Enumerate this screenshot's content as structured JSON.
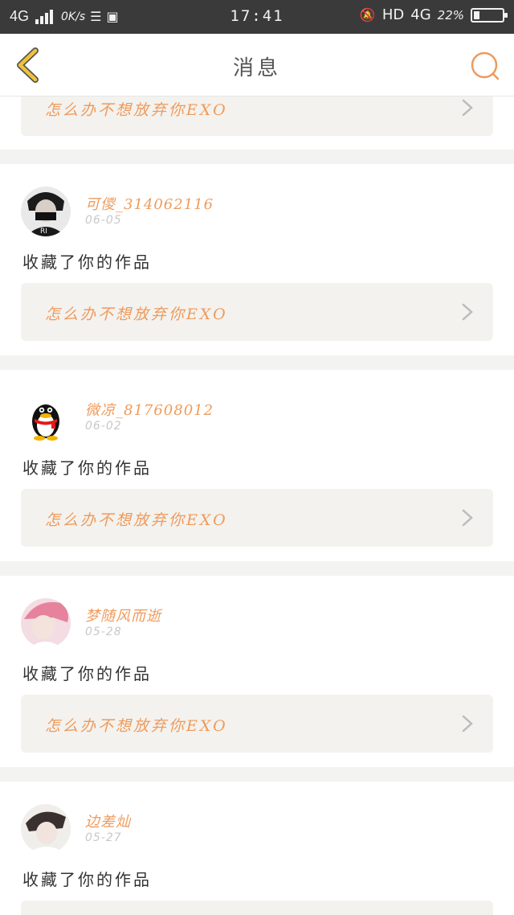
{
  "status_bar": {
    "network_left": "4G",
    "speed": "0K/s",
    "time": "17:41",
    "hd": "HD",
    "network_right": "4G",
    "battery": "22%",
    "battery_level": 0.22
  },
  "header": {
    "title": "消息",
    "back_icon": "chevron-left-icon",
    "search_icon": "search-icon"
  },
  "top_partial": {
    "work_title": "怎么办不想放弃你EXO"
  },
  "notifications": [
    {
      "username": "可儍_314062116",
      "date": "06-05",
      "action": "收藏了你的作品",
      "work_title": "怎么办不想放弃你EXO"
    },
    {
      "username": "微凉_817608012",
      "date": "06-02",
      "action": "收藏了你的作品",
      "work_title": "怎么办不想放弃你EXO"
    },
    {
      "username": "梦随风而逝",
      "date": "05-28",
      "action": "收藏了你的作品",
      "work_title": "怎么办不想放弃你EXO"
    },
    {
      "username": "边差灿",
      "date": "05-27",
      "action": "收藏了你的作品",
      "work_title": ""
    }
  ],
  "colors": {
    "accent": "#ef9a5c",
    "back_arrow": "#f0c23a",
    "status_bar": "#3a3a3a"
  }
}
